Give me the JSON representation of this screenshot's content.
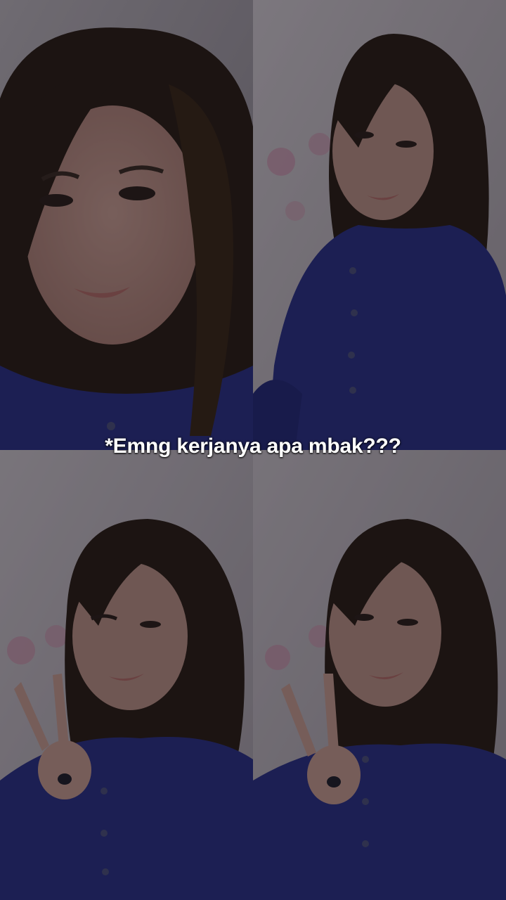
{
  "caption": {
    "text": "*Emng kerjanya apa mbak???"
  },
  "photos": [
    {
      "name": "photo-closeup"
    },
    {
      "name": "photo-seated"
    },
    {
      "name": "photo-wink-peace"
    },
    {
      "name": "photo-peace"
    }
  ],
  "colors": {
    "shirt": "#2a2f86",
    "hair": "#2a1d16",
    "skin": "#b78a80",
    "curtain": "#c9c1c8",
    "caption_text": "#ffffff"
  }
}
